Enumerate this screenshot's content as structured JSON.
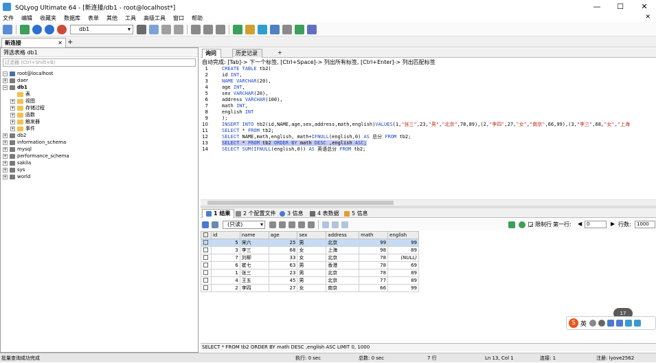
{
  "window": {
    "title": "SQLyog Ultimate 64 - [新连接/db1 - root@localhost*]"
  },
  "menu": [
    "文件",
    "编辑",
    "收藏夹",
    "数据库",
    "表单",
    "其他",
    "工具",
    "高级工具",
    "窗口",
    "帮助"
  ],
  "toolbar": {
    "db_selector": "db1"
  },
  "connection_tab": {
    "label": "新连接"
  },
  "object_browser": {
    "header": "筛选表格 db1",
    "filter_placeholder": "过滤器 (Ctrl+Shift+B)",
    "root": "root@localhost",
    "databases_before": [
      "daer"
    ],
    "active_db": "db1",
    "db1_children": [
      "表",
      "视图",
      "存储过程",
      "函数",
      "触发器",
      "事件"
    ],
    "databases_after": [
      "db2",
      "information_schema",
      "mysql",
      "performance_schema",
      "sakila",
      "sys",
      "world"
    ]
  },
  "editor_tabs": [
    "询问",
    "历史记录"
  ],
  "editor_hint": "自动完成:  [Tab]-> 下一个标签,  [Ctrl+Space]-> 列出所有标签,  [Ctrl+Enter]-> 列出匹配标签",
  "editor_lines": [
    "CREATE TABLE tb2(",
    "id INT,",
    "NAME VARCHAR(20),",
    "age INT,",
    "sex VARCHAR(20),",
    "address VARCHAR(100),",
    "math INT,",
    "english INT",
    ");",
    "INSERT INTO tb2(id,NAME,age,sex,address,math,english)VALUES(1,\"张三\",23,\"男\",\"北京\",78,89),(2,\"李四\",27,\"女\",\"南京\",66,99),(3,\"李三\",68,\"女\",\"上海",
    "SELECT * FROM tb2;",
    "SELECT NAME,math,english, math+IFNULL(english,0) AS 总分 FROM tb2;",
    "SELECT * FROM tb2 ORDER BY math DESC ,english ASC;",
    "SELECT SUM(IFNULL(english,0)) AS 英语总分 FROM tb2;"
  ],
  "result_tabs": [
    "1 结果",
    "2 个配置文件",
    "3 信息",
    "4 表数据",
    "5 信息"
  ],
  "result_toolbar": {
    "mode": "(只读)",
    "limit_label": "限制行",
    "first_row_label": "第一行:",
    "first_row": "0",
    "rows_label": "行数:",
    "rows": "1000"
  },
  "grid": {
    "columns": [
      "id",
      "name",
      "age",
      "sex",
      "address",
      "math",
      "english"
    ],
    "rows": [
      [
        "5",
        "宋六",
        "25",
        "男",
        "北京",
        "99",
        "99"
      ],
      [
        "3",
        "李三",
        "68",
        "女",
        "上海",
        "98",
        "89"
      ],
      [
        "7",
        "刘柳",
        "33",
        "女",
        "北京",
        "78",
        "(NULL)"
      ],
      [
        "6",
        "崔七",
        "63",
        "男",
        "香港",
        "78",
        "69"
      ],
      [
        "1",
        "张三",
        "23",
        "男",
        "北京",
        "78",
        "89"
      ],
      [
        "4",
        "王五",
        "45",
        "男",
        "北京",
        "77",
        "89"
      ],
      [
        "2",
        "李四",
        "27",
        "女",
        "南京",
        "66",
        "99"
      ]
    ]
  },
  "result_query": "SELECT * FROM tb2 ORDER BY math DESC ,english ASC LIMIT 0, 1000",
  "status": {
    "left": "批量查询成功完成",
    "exec": "执行: 0 sec",
    "total": "总数: 0 sec",
    "rows": "7 行",
    "pos": "Ln 13, Col 1",
    "conn": "连接: 1",
    "reg": "注册: lyove2562"
  },
  "ime": {
    "speed": "17"
  }
}
